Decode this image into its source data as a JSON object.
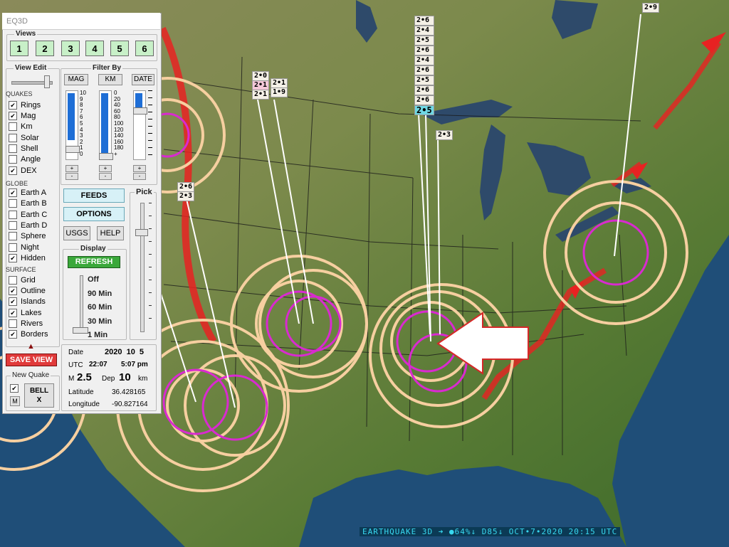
{
  "window": {
    "title": "EQ3D"
  },
  "views": {
    "label": "Views",
    "buttons": [
      "1",
      "2",
      "3",
      "4",
      "5",
      "6"
    ]
  },
  "view_edit": {
    "label": "View Edit"
  },
  "filter": {
    "label": "Filter By",
    "mag_btn": "MAG",
    "km_btn": "KM",
    "date_btn": "DATE",
    "mag_scale": [
      "10",
      "9",
      "8",
      "7",
      "6",
      "5",
      "4",
      "3",
      "2",
      "1",
      "0"
    ],
    "km_scale": [
      "0",
      "20",
      "40",
      "60",
      "80",
      "100",
      "120",
      "140",
      "160",
      "180",
      "+"
    ],
    "plus": "+",
    "minus": "-"
  },
  "quakes": {
    "label": "QUAKES",
    "items": [
      {
        "label": "Rings",
        "checked": true
      },
      {
        "label": "Mag",
        "checked": true
      },
      {
        "label": "Km",
        "checked": false
      },
      {
        "label": "Solar",
        "checked": false
      },
      {
        "label": "Shell",
        "checked": false
      },
      {
        "label": "Angle",
        "checked": false
      },
      {
        "label": "DEX",
        "checked": true
      }
    ]
  },
  "globe": {
    "label": "GLOBE",
    "items": [
      {
        "label": "Earth A",
        "checked": true
      },
      {
        "label": "Earth B",
        "checked": false
      },
      {
        "label": "Earth C",
        "checked": false
      },
      {
        "label": "Earth D",
        "checked": false
      },
      {
        "label": "Sphere",
        "checked": false
      },
      {
        "label": "Night",
        "checked": false
      },
      {
        "label": "Hidden",
        "checked": true
      }
    ]
  },
  "surface": {
    "label": "SURFACE",
    "items": [
      {
        "label": "Grid",
        "checked": false
      },
      {
        "label": "Outline",
        "checked": true
      },
      {
        "label": "Islands",
        "checked": true
      },
      {
        "label": "Lakes",
        "checked": true
      },
      {
        "label": "Rivers",
        "checked": false
      },
      {
        "label": "Borders",
        "checked": true
      }
    ]
  },
  "buttons": {
    "feeds": "FEEDS",
    "options": "OPTIONS",
    "usgs": "USGS",
    "help": "HELP",
    "save_view": "SAVE VIEW",
    "refresh": "REFRESH",
    "bell": "BELL",
    "bell_x": "X"
  },
  "pick": {
    "label": "Pick"
  },
  "display": {
    "label": "Display",
    "options": [
      "Off",
      "90 Min",
      "60 Min",
      "30 Min",
      "1 Min"
    ]
  },
  "new_quake": {
    "label": "New Quake",
    "m_label": "M"
  },
  "quake_info": {
    "date_label": "Date",
    "date": "2020  10  5",
    "utc_label": "UTC",
    "utc": "22:07",
    "local": "5:07 pm",
    "mag_label": "M",
    "mag": "2.5",
    "dep_label": "Dep",
    "dep": "10",
    "dep_unit": "km",
    "lat_label": "Latitude",
    "lat": "36.428165",
    "lon_label": "Longitude",
    "lon": "-90.827164"
  },
  "map_tags": {
    "stack_center": [
      "2•6",
      "2•4",
      "2•5",
      "2•6",
      "2•4",
      "2•6",
      "2•5",
      "2•6",
      "2•6"
    ],
    "highlight": "2•5",
    "t_23_mid": "2•3",
    "t_nw1": "2•0",
    "t_nw2": "2•1",
    "t_nw3": "2•1",
    "t_nw4": "2•1",
    "t_nw5": "1•9",
    "t_w1": "2•6",
    "t_w2": "2•3",
    "t_ne": "2•9"
  },
  "status_bar": "EARTHQUAKE 3D  ➜  ●64%↓ D85↓ OCT•7•2020 20:15 UTC",
  "colors": {
    "ring": "#f6cfa0",
    "ring_pink": "#d92ad0",
    "arrow": "#e82222",
    "land": "#5c7a3a",
    "water": "#1f4e78",
    "lake": "#2e4a6a"
  }
}
